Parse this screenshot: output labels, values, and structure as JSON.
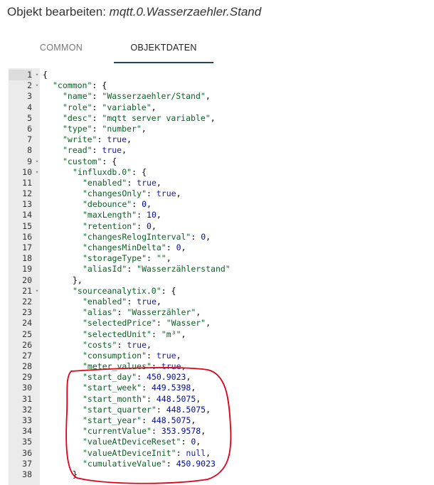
{
  "dialog": {
    "title_prefix": "Objekt bearbeiten: ",
    "object_id": "mqtt.0.Wasserzaehler.Stand"
  },
  "tabs": [
    {
      "label": "COMMON",
      "active": false
    },
    {
      "label": "OBJEKTDATEN",
      "active": true
    }
  ],
  "colors": {
    "key": "#0b6125",
    "string": "#0b6125",
    "boolean": "#1d1d9c",
    "number": "#000aa0",
    "tab_underline": "#26455a",
    "gutter": "#ebebeb",
    "annotation_circle": "#e0001a"
  },
  "editor": {
    "lines": [
      {
        "n": "1",
        "fold": true,
        "indent": 0,
        "tokens": [
          {
            "t": "p",
            "v": "{"
          }
        ]
      },
      {
        "n": "2",
        "fold": true,
        "indent": 1,
        "tokens": [
          {
            "t": "k",
            "v": "\"common\""
          },
          {
            "t": "p",
            "v": ": {"
          }
        ]
      },
      {
        "n": "3",
        "fold": false,
        "indent": 2,
        "tokens": [
          {
            "t": "k",
            "v": "\"name\""
          },
          {
            "t": "p",
            "v": ": "
          },
          {
            "t": "s",
            "v": "\"Wasserzaehler/Stand\""
          },
          {
            "t": "p",
            "v": ","
          }
        ]
      },
      {
        "n": "4",
        "fold": false,
        "indent": 2,
        "tokens": [
          {
            "t": "k",
            "v": "\"role\""
          },
          {
            "t": "p",
            "v": ": "
          },
          {
            "t": "s",
            "v": "\"variable\""
          },
          {
            "t": "p",
            "v": ","
          }
        ]
      },
      {
        "n": "5",
        "fold": false,
        "indent": 2,
        "tokens": [
          {
            "t": "k",
            "v": "\"desc\""
          },
          {
            "t": "p",
            "v": ": "
          },
          {
            "t": "s",
            "v": "\"mqtt server variable\""
          },
          {
            "t": "p",
            "v": ","
          }
        ]
      },
      {
        "n": "6",
        "fold": false,
        "indent": 2,
        "tokens": [
          {
            "t": "k",
            "v": "\"type\""
          },
          {
            "t": "p",
            "v": ": "
          },
          {
            "t": "s",
            "v": "\"number\""
          },
          {
            "t": "p",
            "v": ","
          }
        ]
      },
      {
        "n": "7",
        "fold": false,
        "indent": 2,
        "tokens": [
          {
            "t": "k",
            "v": "\"write\""
          },
          {
            "t": "p",
            "v": ": "
          },
          {
            "t": "kw",
            "v": "true"
          },
          {
            "t": "p",
            "v": ","
          }
        ]
      },
      {
        "n": "8",
        "fold": false,
        "indent": 2,
        "tokens": [
          {
            "t": "k",
            "v": "\"read\""
          },
          {
            "t": "p",
            "v": ": "
          },
          {
            "t": "kw",
            "v": "true"
          },
          {
            "t": "p",
            "v": ","
          }
        ]
      },
      {
        "n": "9",
        "fold": true,
        "indent": 2,
        "tokens": [
          {
            "t": "k",
            "v": "\"custom\""
          },
          {
            "t": "p",
            "v": ": {"
          }
        ]
      },
      {
        "n": "10",
        "fold": true,
        "indent": 3,
        "tokens": [
          {
            "t": "k",
            "v": "\"influxdb.0\""
          },
          {
            "t": "p",
            "v": ": {"
          }
        ]
      },
      {
        "n": "11",
        "fold": false,
        "indent": 4,
        "tokens": [
          {
            "t": "k",
            "v": "\"enabled\""
          },
          {
            "t": "p",
            "v": ": "
          },
          {
            "t": "kw",
            "v": "true"
          },
          {
            "t": "p",
            "v": ","
          }
        ]
      },
      {
        "n": "12",
        "fold": false,
        "indent": 4,
        "tokens": [
          {
            "t": "k",
            "v": "\"changesOnly\""
          },
          {
            "t": "p",
            "v": ": "
          },
          {
            "t": "kw",
            "v": "true"
          },
          {
            "t": "p",
            "v": ","
          }
        ]
      },
      {
        "n": "13",
        "fold": false,
        "indent": 4,
        "tokens": [
          {
            "t": "k",
            "v": "\"debounce\""
          },
          {
            "t": "p",
            "v": ": "
          },
          {
            "t": "n",
            "v": "0"
          },
          {
            "t": "p",
            "v": ","
          }
        ]
      },
      {
        "n": "14",
        "fold": false,
        "indent": 4,
        "tokens": [
          {
            "t": "k",
            "v": "\"maxLength\""
          },
          {
            "t": "p",
            "v": ": "
          },
          {
            "t": "n",
            "v": "10"
          },
          {
            "t": "p",
            "v": ","
          }
        ]
      },
      {
        "n": "15",
        "fold": false,
        "indent": 4,
        "tokens": [
          {
            "t": "k",
            "v": "\"retention\""
          },
          {
            "t": "p",
            "v": ": "
          },
          {
            "t": "n",
            "v": "0"
          },
          {
            "t": "p",
            "v": ","
          }
        ]
      },
      {
        "n": "16",
        "fold": false,
        "indent": 4,
        "tokens": [
          {
            "t": "k",
            "v": "\"changesRelogInterval\""
          },
          {
            "t": "p",
            "v": ": "
          },
          {
            "t": "n",
            "v": "0"
          },
          {
            "t": "p",
            "v": ","
          }
        ]
      },
      {
        "n": "17",
        "fold": false,
        "indent": 4,
        "tokens": [
          {
            "t": "k",
            "v": "\"changesMinDelta\""
          },
          {
            "t": "p",
            "v": ": "
          },
          {
            "t": "n",
            "v": "0"
          },
          {
            "t": "p",
            "v": ","
          }
        ]
      },
      {
        "n": "18",
        "fold": false,
        "indent": 4,
        "tokens": [
          {
            "t": "k",
            "v": "\"storageType\""
          },
          {
            "t": "p",
            "v": ": "
          },
          {
            "t": "s",
            "v": "\"\""
          },
          {
            "t": "p",
            "v": ","
          }
        ]
      },
      {
        "n": "19",
        "fold": false,
        "indent": 4,
        "tokens": [
          {
            "t": "k",
            "v": "\"aliasId\""
          },
          {
            "t": "p",
            "v": ": "
          },
          {
            "t": "s",
            "v": "\"Wasserzählerstand\""
          }
        ]
      },
      {
        "n": "20",
        "fold": false,
        "indent": 3,
        "tokens": [
          {
            "t": "p",
            "v": "},"
          }
        ]
      },
      {
        "n": "21",
        "fold": true,
        "indent": 3,
        "tokens": [
          {
            "t": "k",
            "v": "\"sourceanalytix.0\""
          },
          {
            "t": "p",
            "v": ": {"
          }
        ]
      },
      {
        "n": "22",
        "fold": false,
        "indent": 4,
        "tokens": [
          {
            "t": "k",
            "v": "\"enabled\""
          },
          {
            "t": "p",
            "v": ": "
          },
          {
            "t": "kw",
            "v": "true"
          },
          {
            "t": "p",
            "v": ","
          }
        ]
      },
      {
        "n": "23",
        "fold": false,
        "indent": 4,
        "tokens": [
          {
            "t": "k",
            "v": "\"alias\""
          },
          {
            "t": "p",
            "v": ": "
          },
          {
            "t": "s",
            "v": "\"Wasserzähler\""
          },
          {
            "t": "p",
            "v": ","
          }
        ]
      },
      {
        "n": "24",
        "fold": false,
        "indent": 4,
        "tokens": [
          {
            "t": "k",
            "v": "\"selectedPrice\""
          },
          {
            "t": "p",
            "v": ": "
          },
          {
            "t": "s",
            "v": "\"Wasser\""
          },
          {
            "t": "p",
            "v": ","
          }
        ]
      },
      {
        "n": "25",
        "fold": false,
        "indent": 4,
        "tokens": [
          {
            "t": "k",
            "v": "\"selectedUnit\""
          },
          {
            "t": "p",
            "v": ": "
          },
          {
            "t": "s",
            "v": "\"m³\""
          },
          {
            "t": "p",
            "v": ","
          }
        ]
      },
      {
        "n": "26",
        "fold": false,
        "indent": 4,
        "tokens": [
          {
            "t": "k",
            "v": "\"costs\""
          },
          {
            "t": "p",
            "v": ": "
          },
          {
            "t": "kw",
            "v": "true"
          },
          {
            "t": "p",
            "v": ","
          }
        ]
      },
      {
        "n": "27",
        "fold": false,
        "indent": 4,
        "tokens": [
          {
            "t": "k",
            "v": "\"consumption\""
          },
          {
            "t": "p",
            "v": ": "
          },
          {
            "t": "kw",
            "v": "true"
          },
          {
            "t": "p",
            "v": ","
          }
        ]
      },
      {
        "n": "28",
        "fold": false,
        "indent": 4,
        "tokens": [
          {
            "t": "k",
            "v": "\"meter_values\""
          },
          {
            "t": "p",
            "v": ": "
          },
          {
            "t": "kw",
            "v": "true"
          },
          {
            "t": "p",
            "v": ","
          }
        ]
      },
      {
        "n": "29",
        "fold": false,
        "indent": 4,
        "tokens": [
          {
            "t": "k",
            "v": "\"start_day\""
          },
          {
            "t": "p",
            "v": ": "
          },
          {
            "t": "n",
            "v": "450.9023"
          },
          {
            "t": "p",
            "v": ","
          }
        ]
      },
      {
        "n": "30",
        "fold": false,
        "indent": 4,
        "tokens": [
          {
            "t": "k",
            "v": "\"start_week\""
          },
          {
            "t": "p",
            "v": ": "
          },
          {
            "t": "n",
            "v": "449.5398"
          },
          {
            "t": "p",
            "v": ","
          }
        ]
      },
      {
        "n": "31",
        "fold": false,
        "indent": 4,
        "tokens": [
          {
            "t": "k",
            "v": "\"start_month\""
          },
          {
            "t": "p",
            "v": ": "
          },
          {
            "t": "n",
            "v": "448.5075"
          },
          {
            "t": "p",
            "v": ","
          }
        ]
      },
      {
        "n": "32",
        "fold": false,
        "indent": 4,
        "tokens": [
          {
            "t": "k",
            "v": "\"start_quarter\""
          },
          {
            "t": "p",
            "v": ": "
          },
          {
            "t": "n",
            "v": "448.5075"
          },
          {
            "t": "p",
            "v": ","
          }
        ]
      },
      {
        "n": "33",
        "fold": false,
        "indent": 4,
        "tokens": [
          {
            "t": "k",
            "v": "\"start_year\""
          },
          {
            "t": "p",
            "v": ": "
          },
          {
            "t": "n",
            "v": "448.5075"
          },
          {
            "t": "p",
            "v": ","
          }
        ]
      },
      {
        "n": "34",
        "fold": false,
        "indent": 4,
        "tokens": [
          {
            "t": "k",
            "v": "\"currentValue\""
          },
          {
            "t": "p",
            "v": ": "
          },
          {
            "t": "n",
            "v": "353.9578"
          },
          {
            "t": "p",
            "v": ","
          }
        ]
      },
      {
        "n": "35",
        "fold": false,
        "indent": 4,
        "tokens": [
          {
            "t": "k",
            "v": "\"valueAtDeviceReset\""
          },
          {
            "t": "p",
            "v": ": "
          },
          {
            "t": "n",
            "v": "0"
          },
          {
            "t": "p",
            "v": ","
          }
        ]
      },
      {
        "n": "36",
        "fold": false,
        "indent": 4,
        "tokens": [
          {
            "t": "k",
            "v": "\"valueAtDeviceInit\""
          },
          {
            "t": "p",
            "v": ": "
          },
          {
            "t": "kw",
            "v": "null"
          },
          {
            "t": "p",
            "v": ","
          }
        ]
      },
      {
        "n": "37",
        "fold": false,
        "indent": 4,
        "tokens": [
          {
            "t": "k",
            "v": "\"cumulativeValue\""
          },
          {
            "t": "p",
            "v": ": "
          },
          {
            "t": "n",
            "v": "450.9023"
          }
        ]
      },
      {
        "n": "38",
        "fold": false,
        "indent": 3,
        "tokens": [
          {
            "t": "p",
            "v": "}"
          }
        ]
      }
    ]
  }
}
